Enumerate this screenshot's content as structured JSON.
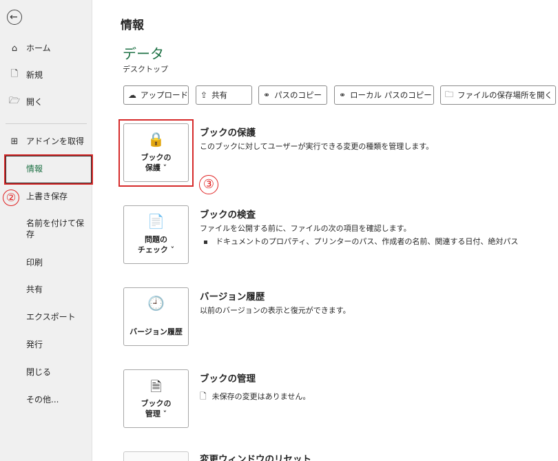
{
  "sidebar": {
    "items": [
      {
        "label": "ホーム",
        "icon": "home-icon"
      },
      {
        "label": "新規",
        "icon": "new-document-icon"
      },
      {
        "label": "開く",
        "icon": "folder-open-icon"
      },
      {
        "label": "アドインを取得",
        "icon": "addins-grid-icon"
      },
      {
        "label": "情報"
      },
      {
        "label": "上書き保存"
      },
      {
        "label": "名前を付けて保存"
      },
      {
        "label": "印刷"
      },
      {
        "label": "共有"
      },
      {
        "label": "エクスポート"
      },
      {
        "label": "発行"
      },
      {
        "label": "閉じる"
      },
      {
        "label": "その他..."
      }
    ],
    "active_color": "#1e7145"
  },
  "annotations": {
    "mark_2": "②",
    "mark_3": "③",
    "highlight_color": "#d62a2a"
  },
  "main": {
    "title": "情報",
    "doc_name": "データ",
    "doc_location": "デスクトップ",
    "toolbar": [
      {
        "label": "アップロード",
        "icon": "upload-cloud-icon"
      },
      {
        "label": "共有",
        "icon": "share-icon"
      },
      {
        "label": "パスのコピー",
        "icon": "link-icon"
      },
      {
        "label": "ローカル パスのコピー",
        "icon": "link-icon"
      },
      {
        "label": "ファイルの保存場所を開く",
        "icon": "folder-icon"
      }
    ],
    "sections": [
      {
        "button_line1": "ブックの",
        "button_line2": "保護 ˅",
        "title": "ブックの保護",
        "desc": "このブックに対してユーザーが実行できる変更の種類を管理します。"
      },
      {
        "button_line1": "問題の",
        "button_line2": "チェック ˅",
        "title": "ブックの検査",
        "desc": "ファイルを公開する前に、ファイルの次の項目を確認します。",
        "bullet": "ドキュメントのプロパティ、プリンターのパス、作成者の名前、関連する日付、絶対パス"
      },
      {
        "button_line1": "バージョン履歴",
        "title": "バージョン履歴",
        "desc": "以前のバージョンの表示と復元ができます。"
      },
      {
        "button_line1": "ブックの",
        "button_line2": "管理 ˅",
        "title": "ブックの管理",
        "desc": "未保存の変更はありません。"
      },
      {
        "title": "変更ウィンドウのリセット"
      }
    ]
  },
  "icons": {
    "back": "←",
    "home": "⌂",
    "new": "🗋",
    "open": "🗁",
    "addins": "⊞",
    "upload": "☁",
    "share": "⇪",
    "link": "⚭",
    "folder": "🗀",
    "lock": "🔒",
    "inspect": "📄",
    "history": "🕘",
    "manage": "🗎",
    "doc_small": "🗋"
  }
}
